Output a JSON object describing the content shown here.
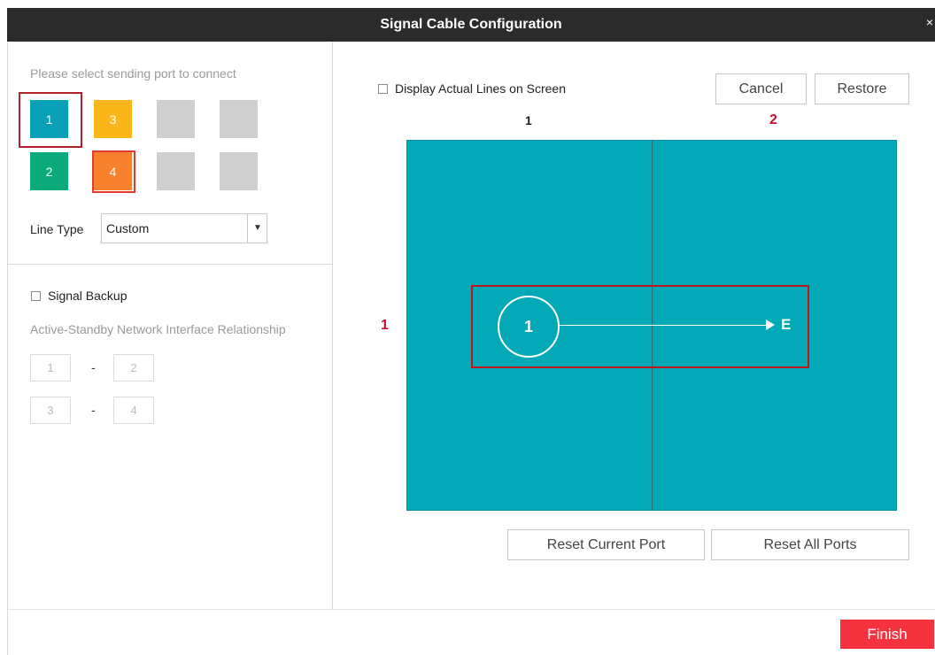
{
  "window": {
    "title": "Signal Cable Configuration",
    "close_glyph": "×"
  },
  "left_panel": {
    "instruction": "Please select sending port to connect",
    "ports": [
      {
        "label": "1",
        "color": "#0aa1b6",
        "selected": true
      },
      {
        "label": "3",
        "color": "#fbb61c",
        "selected": false
      },
      {
        "label": "",
        "color": "#cfcfcf",
        "selected": false
      },
      {
        "label": "",
        "color": "#cfcfcf",
        "selected": false
      },
      {
        "label": "2",
        "color": "#0aaa7a",
        "selected": false
      },
      {
        "label": "4",
        "color": "#f7812d",
        "selected": false
      },
      {
        "label": "",
        "color": "#cfcfcf",
        "selected": false
      },
      {
        "label": "",
        "color": "#cfcfcf",
        "selected": false
      }
    ],
    "line_type_label": "Line Type",
    "line_type_value": "Custom",
    "signal_backup_label": "Signal Backup",
    "relationship_label": "Active-Standby Network Interface Relationship",
    "pairs": [
      {
        "a": "1",
        "sep": "-",
        "b": "2"
      },
      {
        "a": "3",
        "sep": "-",
        "b": "4"
      }
    ]
  },
  "right_panel": {
    "display_lines_label": "Display Actual Lines on Screen",
    "cancel_label": "Cancel",
    "restore_label": "Restore",
    "column_labels": [
      "1",
      "2"
    ],
    "row_labels": [
      "1"
    ],
    "route": {
      "start": "1",
      "end": "E"
    },
    "reset_current_label": "Reset Current Port",
    "reset_all_label": "Reset All Ports"
  },
  "footer": {
    "finish_label": "Finish"
  }
}
